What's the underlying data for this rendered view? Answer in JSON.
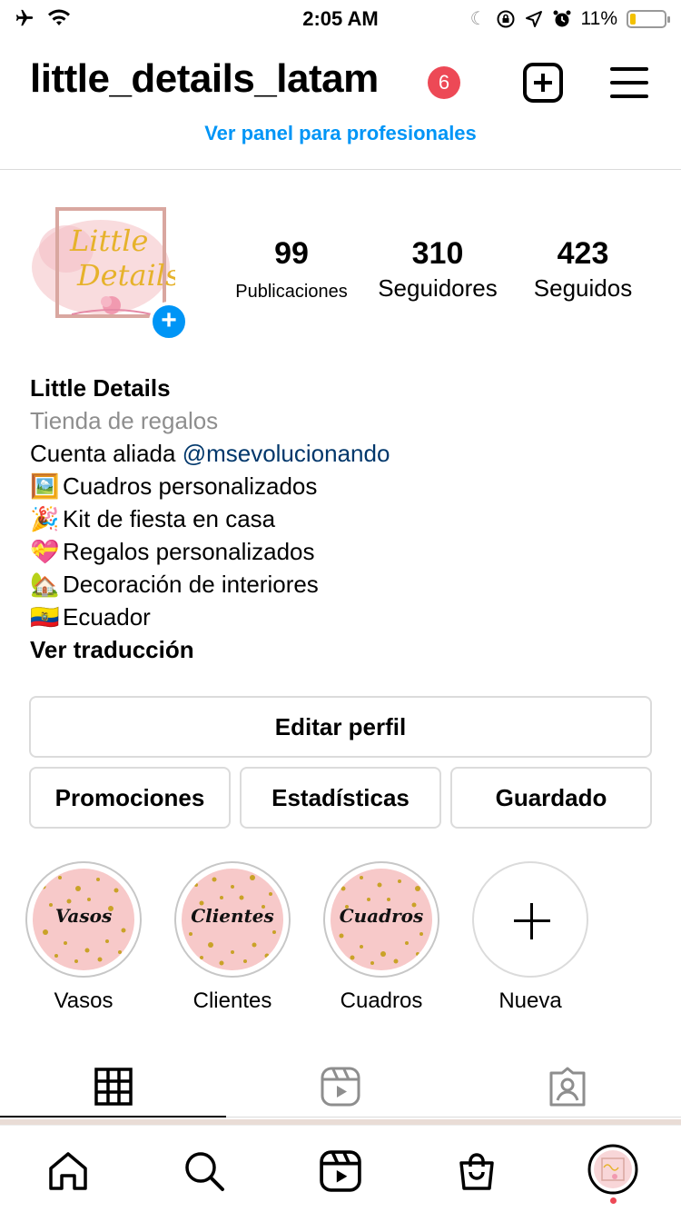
{
  "status_bar": {
    "time": "2:05 AM",
    "battery_text": "11%",
    "icons": [
      "airplane-icon",
      "wifi-icon",
      "moon-icon",
      "rotation-lock-icon",
      "location-icon",
      "alarm-icon",
      "battery-icon"
    ]
  },
  "header": {
    "username": "little_details_latam",
    "notification_count": "6",
    "panel_link": "Ver panel para profesionales"
  },
  "stats": [
    {
      "value": "99",
      "label": "Publicaciones"
    },
    {
      "value": "310",
      "label": "Seguidores"
    },
    {
      "value": "423",
      "label": "Seguidos"
    }
  ],
  "bio": {
    "name": "Little Details",
    "category": "Tienda de regalos",
    "line1_prefix": "Cuenta aliada ",
    "line1_mention": "@msevolucionando",
    "items": [
      {
        "emoji": "🖼️",
        "text": "Cuadros personalizados"
      },
      {
        "emoji": "🎉",
        "text": "Kit de fiesta en casa"
      },
      {
        "emoji": "💝",
        "text": "Regalos personalizados"
      },
      {
        "emoji": "🏡",
        "text": "Decoración de interiores"
      },
      {
        "emoji": "🇪🇨",
        "text": "Ecuador"
      }
    ],
    "see_translation": "Ver traducción"
  },
  "buttons": {
    "edit_profile": "Editar perfil",
    "promotions": "Promociones",
    "insights": "Estadísticas",
    "saved": "Guardado"
  },
  "highlights": [
    {
      "label": "Vasos",
      "cover_text": "Vasos"
    },
    {
      "label": "Clientes",
      "cover_text": "Clientes"
    },
    {
      "label": "Cuadros",
      "cover_text": "Cuadros"
    },
    {
      "label": "Nueva",
      "cover_text": ""
    }
  ],
  "avatar": {
    "logo_text_1": "Little",
    "logo_text_2": "Details"
  },
  "colors": {
    "accent": "#0095f6",
    "badge": "#ed4956",
    "mention": "#00376b"
  }
}
